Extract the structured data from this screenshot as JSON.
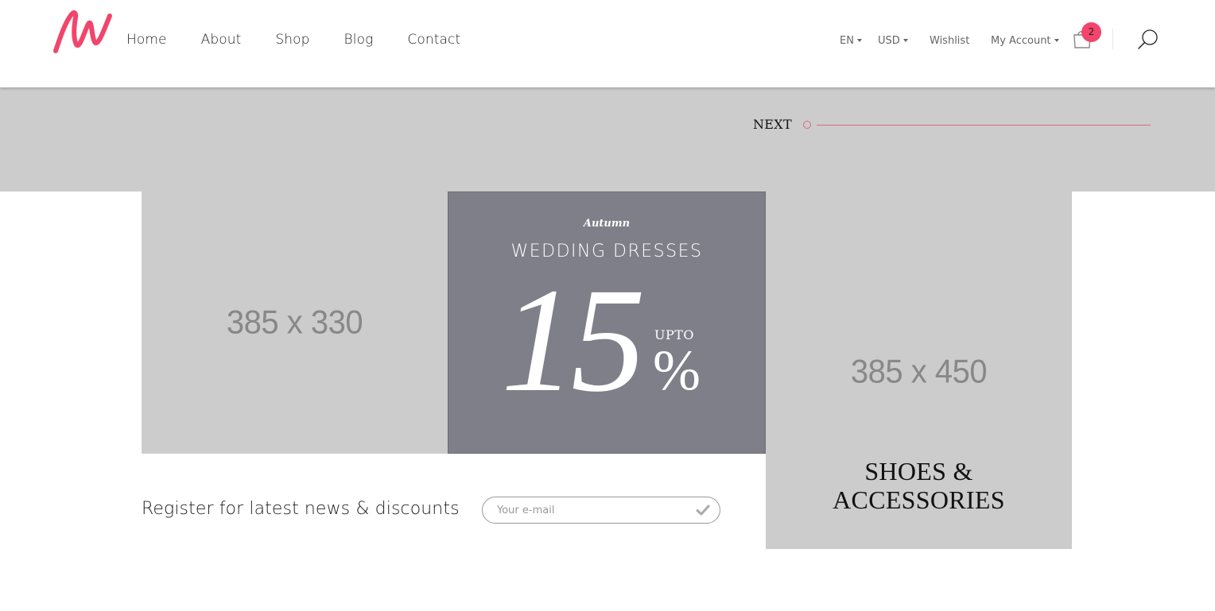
{
  "brand": {
    "accent": "#f2456b",
    "logo_alt": "logo-mark"
  },
  "nav": {
    "items": [
      {
        "label": "Home"
      },
      {
        "label": "About"
      },
      {
        "label": "Shop"
      },
      {
        "label": "Blog"
      },
      {
        "label": "Contact"
      }
    ]
  },
  "topbar": {
    "language": "EN",
    "currency": "USD",
    "wishlist": "Wishlist",
    "account": "My Account",
    "cart_count": "2",
    "icons": [
      "shopping-bag-icon",
      "search-icon"
    ]
  },
  "slider": {
    "next_label": "NEXT"
  },
  "tiles": {
    "left_placeholder": "385 x 330",
    "promo": {
      "season": "Autumn",
      "title": "WEDDING DRESSES",
      "number": "15",
      "upto": "UPTO",
      "percent": "%"
    },
    "right_placeholder": "385 x 450",
    "right_title_line1": "SHOES &",
    "right_title_line2": "ACCESSORIES"
  },
  "newsletter": {
    "heading": "Register for latest news & discounts",
    "placeholder": "Your e-mail",
    "value": ""
  }
}
